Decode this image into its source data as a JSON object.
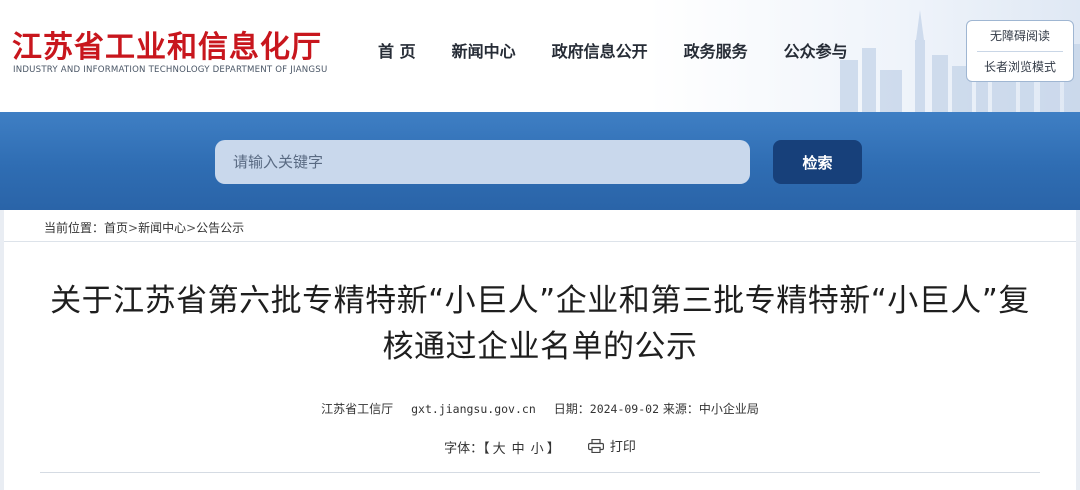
{
  "header": {
    "title": "江苏省工业和信息化厅",
    "subtitle": "INDUSTRY AND INFORMATION TECHNOLOGY DEPARTMENT OF JIANGSU",
    "nav": [
      "首 页",
      "新闻中心",
      "政府信息公开",
      "政务服务",
      "公众参与"
    ],
    "accessibility": [
      "无障碍阅读",
      "长者浏览模式"
    ]
  },
  "search": {
    "placeholder": "请输入关键字",
    "button_label": "检索"
  },
  "breadcrumb": {
    "prefix": "当前位置：",
    "items": [
      "首页",
      "新闻中心",
      "公告公示"
    ],
    "separator": ">"
  },
  "article": {
    "title": "关于江苏省第六批专精特新“小巨人”企业和第三批专精特新“小巨人”复核通过企业名单的公示",
    "publisher": "江苏省工信厅",
    "site": "gxt.jiangsu.gov.cn",
    "date_label": "日期：",
    "date": "2024-09-02",
    "source_label": "来源：",
    "source": "中小企业局"
  },
  "tools": {
    "font_label": "字体：【",
    "sizes": [
      "大",
      "中",
      "小"
    ],
    "font_close": "】",
    "print_label": "打印"
  },
  "colors": {
    "brand_red": "#c8161d",
    "band_blue": "#2f6db3",
    "button_navy": "#17407a"
  }
}
